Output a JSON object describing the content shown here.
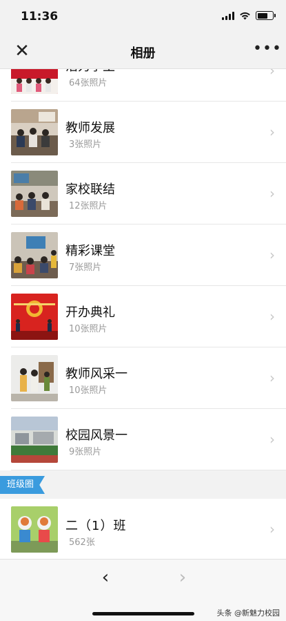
{
  "status": {
    "time": "11:36"
  },
  "nav": {
    "title": "相册",
    "close_glyph": "✕",
    "more_glyph": "•••"
  },
  "albums": [
    {
      "name": "活力学生",
      "count": "64张照片",
      "thumb": "red-stage-performance"
    },
    {
      "name": "教师发展",
      "count": "3张照片",
      "thumb": "meeting-room"
    },
    {
      "name": "家校联结",
      "count": "12张照片",
      "thumb": "parents-classroom"
    },
    {
      "name": "精彩课堂",
      "count": "7张照片",
      "thumb": "classroom-projector"
    },
    {
      "name": "开办典礼",
      "count": "10张照片",
      "thumb": "ceremony-red-backdrop"
    },
    {
      "name": "教师风采一",
      "count": "10张照片",
      "thumb": "teachers-standing"
    },
    {
      "name": "校园风景一",
      "count": "9张照片",
      "thumb": "campus-field"
    }
  ],
  "section": {
    "tag": "班级圈"
  },
  "class_item": {
    "name": "二（1）班",
    "count": "562张",
    "thumb": "cartoon-standees"
  },
  "chevron_glyph": "›",
  "toolbar": {
    "back_glyph": "‹",
    "forward_glyph": "›"
  },
  "watermark": "头条 @新魅力校园"
}
